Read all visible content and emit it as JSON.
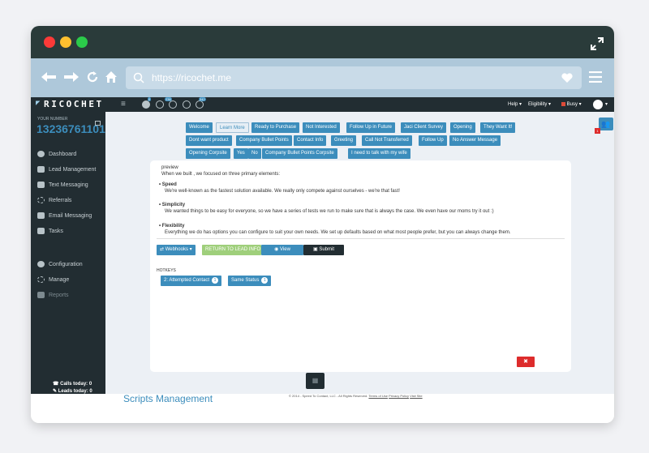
{
  "browser": {
    "url": "https://ricochet.me"
  },
  "brand": {
    "logo": "RICOCHET"
  },
  "topbar": {
    "help": "Help",
    "eligibility": "Eligibility",
    "status": "Busy",
    "counters": [
      "0",
      "0",
      "236",
      "0",
      "342"
    ]
  },
  "sidebar": {
    "number_label": "YOUR NUMBER",
    "number": "13236761101",
    "items": [
      "Dashboard",
      "Lead Management",
      "Text Messaging",
      "Referrals",
      "Email Messaging",
      "Tasks"
    ],
    "items2": [
      "Configuration",
      "Manage",
      "Reports"
    ],
    "calls": "Calls today: 0",
    "leads": "Leads today: 0"
  },
  "script_buttons": [
    "Welcome",
    "Learn More",
    "Ready to Purchase",
    "Not Interested",
    "Follow Up in Future",
    "Jaci Client Survey",
    "Opening",
    "They Want It!",
    "Dont want product",
    "Company Bullet Points",
    "Contact Info",
    "Greeting",
    "Call Not Transferred",
    "Follow Up",
    "No Answer Message",
    "Opening Corpsite",
    "Yes",
    "No",
    "Company Bullet Points Corpsite",
    "I need to talk with my wife"
  ],
  "preview": {
    "label": "preview",
    "intro": "When we built , we focused on three primary elements:",
    "points": [
      {
        "title": "Speed",
        "text": "We're well-known as the fastest solution available. We really only compete against ourselves - we're that fast!"
      },
      {
        "title": "Simplicity",
        "text": "We wanted things to be easy for everyone, so we have a series of tests we run to make sure that is always the case. We even have our moms try it out :)"
      },
      {
        "title": "Flexibility",
        "text": "Everything we do has options you can configure to suit your own needs. We set up defaults based on what most people prefer, but you can always change them."
      }
    ]
  },
  "actions": {
    "webhooks": "Webhooks",
    "return": "RETURN TO LEAD INFO",
    "view": "View",
    "submit": "Submit"
  },
  "hotkeys": {
    "label": "HOTKEYS",
    "items": [
      {
        "label": "2: Attempted Contact",
        "count": "1"
      },
      {
        "label": "Same Status",
        "count": "1"
      }
    ]
  },
  "page": {
    "title": "Scripts Management",
    "footer": "© 2014 - Speed To Contact, LLC - All Rights Reserved.",
    "terms": "Terms of Use",
    "privacy": "Privacy Policy",
    "visit": "Visit Site"
  },
  "colors": {
    "accent": "#3c8dbc",
    "close": "#dd2c2c"
  }
}
